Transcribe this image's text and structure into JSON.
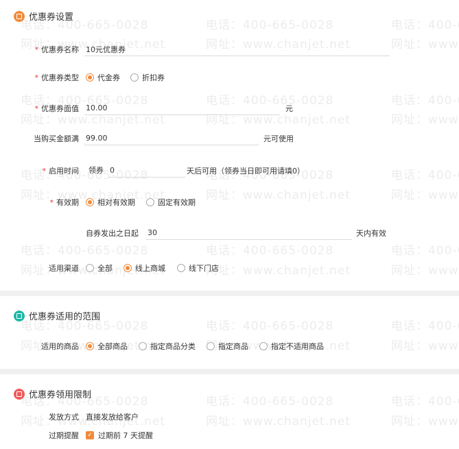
{
  "section1": {
    "title": "优惠券设置",
    "name_label": "优惠券名称",
    "name_value": "10元优惠券",
    "type_label": "优惠券类型",
    "type_options": [
      "代金券",
      "折扣券"
    ],
    "face_label": "优惠券面值",
    "face_value": "10.00",
    "face_unit": "元",
    "min_label": "当购买金额满",
    "min_value": "99.00",
    "min_unit": "元可使用",
    "start_label": "启用时间",
    "start_prefix": "领券",
    "start_value": "0",
    "start_suffix": "天后可用（领券当日即可用请填0）",
    "valid_label": "有效期",
    "valid_options": [
      "相对有效期",
      "固定有效期"
    ],
    "valid_prefix": "自券发出之日起",
    "valid_value": "30",
    "valid_suffix": "天内有效",
    "channel_label": "适用渠道",
    "channel_options": [
      "全部",
      "线上商城",
      "线下门店"
    ]
  },
  "section2": {
    "title": "优惠券适用的范围",
    "goods_label": "适用的商品",
    "goods_options": [
      "全部商品",
      "指定商品分类",
      "指定商品",
      "指定不适用商品"
    ]
  },
  "section3": {
    "title": "优惠券领用限制",
    "issue_label": "发放方式",
    "issue_value": "直接发放给客户",
    "remind_label": "过期提醒",
    "remind_text": "过期前 7 天提醒"
  },
  "watermark": {
    "phone": "电话：400-665-0028",
    "site": "网址：www.chanjet.net"
  },
  "colors": {
    "accent": "#f08a3a",
    "required": "#e4393c"
  }
}
